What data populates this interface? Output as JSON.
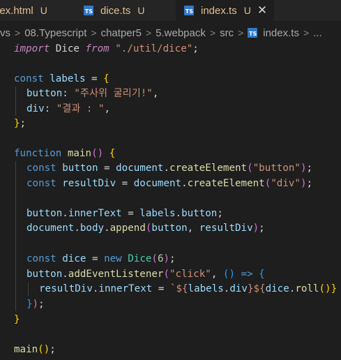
{
  "tabs": [
    {
      "name": "lex.html",
      "status": "U"
    },
    {
      "name": "dice.ts",
      "status": "U"
    },
    {
      "name": "index.ts",
      "status": "U",
      "active": true
    }
  ],
  "breadcrumb": [
    "vs",
    "08.Typescript",
    "chatper5",
    "5.webpack",
    "src",
    "index.ts",
    "..."
  ],
  "code": {
    "l1": [
      "import",
      " ",
      "Dice",
      " ",
      "from",
      " ",
      "\"./util/dice\"",
      ";"
    ],
    "l3": [
      "const",
      " ",
      "labels",
      " = ",
      "{"
    ],
    "l4": [
      "button",
      ": ",
      "\"주사위 굴리기!\"",
      ","
    ],
    "l5": [
      "div",
      ": ",
      "\"결과 : \"",
      ","
    ],
    "l6": [
      "}",
      ";"
    ],
    "l8": [
      "function",
      " ",
      "main",
      "(",
      ")",
      " ",
      "{"
    ],
    "l9": [
      "const",
      " ",
      "button",
      " = ",
      "document",
      ".",
      "createElement",
      "(",
      "\"button\"",
      ")",
      ";"
    ],
    "l10": [
      "const",
      " ",
      "resultDiv",
      " = ",
      "document",
      ".",
      "createElement",
      "(",
      "\"div\"",
      ")",
      ";"
    ],
    "l12": [
      "button",
      ".",
      "innerText",
      " = ",
      "labels",
      ".",
      "button",
      ";"
    ],
    "l13": [
      "document",
      ".",
      "body",
      ".",
      "append",
      "(",
      "button",
      ", ",
      "resultDiv",
      ")",
      ";"
    ],
    "l15": [
      "const",
      " ",
      "dice",
      " = ",
      "new",
      " ",
      "Dice",
      "(",
      "6",
      ")",
      ";"
    ],
    "l16": [
      "button",
      ".",
      "addEventListener",
      "(",
      "\"click\"",
      ", ",
      "(",
      ")",
      " => ",
      "{"
    ],
    "l17": [
      "resultDiv",
      ".",
      "innerText",
      " = ",
      "`${",
      "labels",
      ".",
      "div",
      "}${",
      "dice",
      ".",
      "roll",
      "()}"
    ],
    "l18": [
      "}",
      ")",
      ";"
    ],
    "l19": [
      "}"
    ],
    "l21": [
      "main",
      "()",
      ";"
    ]
  }
}
